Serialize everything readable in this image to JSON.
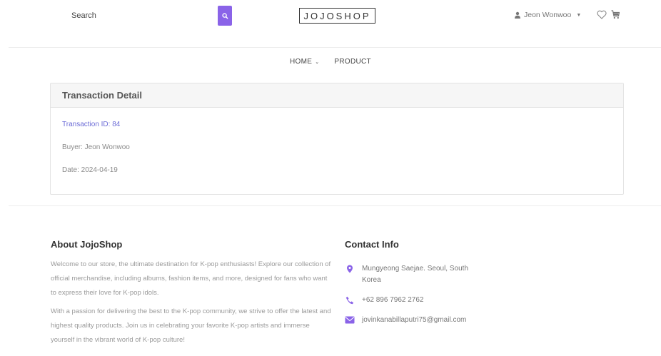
{
  "header": {
    "search_placeholder": "Search",
    "logo_text": "JOJOSHOP",
    "user_name": "Jeon Wonwoo",
    "accent_color": "#8a63e8"
  },
  "nav": {
    "items": [
      {
        "label": "HOME",
        "has_dropdown": true
      },
      {
        "label": "PRODUCT",
        "has_dropdown": false
      }
    ]
  },
  "transaction": {
    "title": "Transaction Detail",
    "id_line": "Transaction ID: 84",
    "buyer_line": "Buyer: Jeon Wonwoo",
    "date_line": "Date: 2024-04-19"
  },
  "footer": {
    "about": {
      "title": "About JojoShop",
      "paragraph1": "Welcome to our store, the ultimate destination for K-pop enthusiasts! Explore our collection of official merchandise, including albums, fashion items, and more, designed for fans who want to express their love for K-pop idols.",
      "paragraph2": "With a passion for delivering the best to the K-pop community, we strive to offer the latest and highest quality products. Join us in celebrating your favorite K-pop artists and immerse yourself in the vibrant world of K-pop culture!"
    },
    "contact": {
      "title": "Contact Info",
      "address": "Mungyeong Saejae. Seoul, South Korea",
      "phone": "+62 896 7962 2762",
      "email": "jovinkanabillaputri75@gmail.com",
      "icon_color": "#8a63e8"
    }
  }
}
